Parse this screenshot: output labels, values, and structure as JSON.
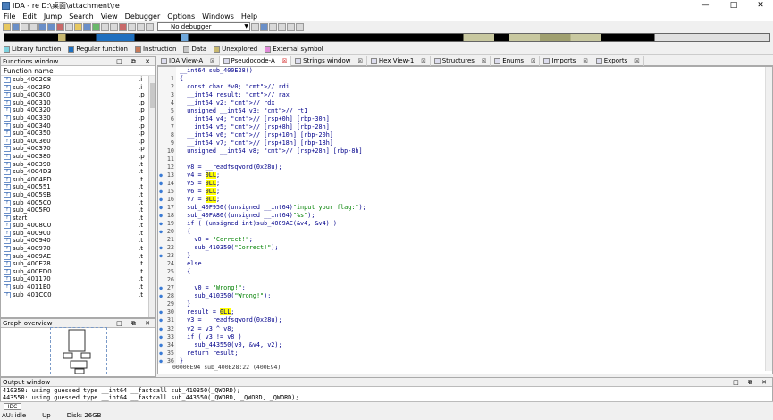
{
  "window": {
    "title": "IDA - re D:\\桌面\\attachment\\re",
    "min": "—",
    "max": "□",
    "close": "✕"
  },
  "menu": [
    "File",
    "Edit",
    "Jump",
    "Search",
    "View",
    "Debugger",
    "Options",
    "Windows",
    "Help"
  ],
  "toolbar": {
    "debugger_select": "No debugger"
  },
  "legend": [
    {
      "label": "Library function",
      "color": "#7fd3e0"
    },
    {
      "label": "Regular function",
      "color": "#1e6fbf"
    },
    {
      "label": "Instruction",
      "color": "#c87a5a"
    },
    {
      "label": "Data",
      "color": "#c8c8c8"
    },
    {
      "label": "Unexplored",
      "color": "#c8b870"
    },
    {
      "label": "External symbol",
      "color": "#e08ad8"
    }
  ],
  "functions_window": {
    "title": "Functions window",
    "header": "Function name",
    "items": [
      {
        "name": "sub_4002C8",
        "seg": ".i"
      },
      {
        "name": "sub_4002F0",
        "seg": ".i"
      },
      {
        "name": "sub_400300",
        "seg": ".p"
      },
      {
        "name": "sub_400310",
        "seg": ".p"
      },
      {
        "name": "sub_400320",
        "seg": ".p"
      },
      {
        "name": "sub_400330",
        "seg": ".p"
      },
      {
        "name": "sub_400340",
        "seg": ".p"
      },
      {
        "name": "sub_400350",
        "seg": ".p"
      },
      {
        "name": "sub_400360",
        "seg": ".p"
      },
      {
        "name": "sub_400370",
        "seg": ".p"
      },
      {
        "name": "sub_400380",
        "seg": ".p"
      },
      {
        "name": "sub_400390",
        "seg": ".t"
      },
      {
        "name": "sub_4004D3",
        "seg": ".t"
      },
      {
        "name": "sub_4004ED",
        "seg": ".t"
      },
      {
        "name": "sub_400551",
        "seg": ".t"
      },
      {
        "name": "sub_40059B",
        "seg": ".t"
      },
      {
        "name": "sub_4005C0",
        "seg": ".t"
      },
      {
        "name": "sub_4005F0",
        "seg": ".t"
      },
      {
        "name": "start",
        "seg": ".t"
      },
      {
        "name": "sub_4008C0",
        "seg": ".t"
      },
      {
        "name": "sub_400900",
        "seg": ".t"
      },
      {
        "name": "sub_400940",
        "seg": ".t"
      },
      {
        "name": "sub_400970",
        "seg": ".t"
      },
      {
        "name": "sub_4009AE",
        "seg": ".t"
      },
      {
        "name": "sub_400E28",
        "seg": ".t"
      },
      {
        "name": "sub_400ED0",
        "seg": ".t"
      },
      {
        "name": "sub_401170",
        "seg": ".t"
      },
      {
        "name": "sub_4011E0",
        "seg": ".t"
      },
      {
        "name": "sub_401CC0",
        "seg": ".t"
      }
    ]
  },
  "graph_overview": {
    "title": "Graph overview"
  },
  "tabs": [
    {
      "label": "IDA View-A"
    },
    {
      "label": "Pseudocode-A"
    },
    {
      "label": "Strings window"
    },
    {
      "label": "Hex View-1"
    },
    {
      "label": "Structures"
    },
    {
      "label": "Enums"
    },
    {
      "label": "Imports"
    },
    {
      "label": "Exports"
    }
  ],
  "code": {
    "header": "__int64 sub_400E28()",
    "lines": [
      {
        "n": "1",
        "dot": false,
        "t": "{"
      },
      {
        "n": "2",
        "dot": false,
        "t": "  const char *v0; // rdi"
      },
      {
        "n": "3",
        "dot": false,
        "t": "  __int64 result; // rax"
      },
      {
        "n": "4",
        "dot": false,
        "t": "  __int64 v2; // rdx"
      },
      {
        "n": "5",
        "dot": false,
        "t": "  unsigned __int64 v3; // rt1"
      },
      {
        "n": "6",
        "dot": false,
        "t": "  __int64 v4; // [rsp+0h] [rbp-30h]"
      },
      {
        "n": "7",
        "dot": false,
        "t": "  __int64 v5; // [rsp+8h] [rbp-28h]"
      },
      {
        "n": "8",
        "dot": false,
        "t": "  __int64 v6; // [rsp+10h] [rbp-20h]"
      },
      {
        "n": "9",
        "dot": false,
        "t": "  __int64 v7; // [rsp+18h] [rbp-18h]"
      },
      {
        "n": "10",
        "dot": false,
        "t": "  unsigned __int64 v8; // [rsp+28h] [rbp-8h]"
      },
      {
        "n": "11",
        "dot": false,
        "t": ""
      },
      {
        "n": "12",
        "dot": false,
        "t": "  v8 = __readfsqword(0x28u);"
      },
      {
        "n": "13",
        "dot": true,
        "t": "  v4 = 0LL;"
      },
      {
        "n": "14",
        "dot": true,
        "t": "  v5 = 0LL;"
      },
      {
        "n": "15",
        "dot": true,
        "t": "  v6 = 0LL;"
      },
      {
        "n": "16",
        "dot": true,
        "t": "  v7 = 0LL;"
      },
      {
        "n": "17",
        "dot": true,
        "t": "  sub_40F950((unsigned __int64)\"input your flag:\");"
      },
      {
        "n": "18",
        "dot": true,
        "t": "  sub_40FA80((unsigned __int64)\"%s\");"
      },
      {
        "n": "19",
        "dot": true,
        "t": "  if ( (unsigned int)sub_4009AE(&v4, &v4) )"
      },
      {
        "n": "20",
        "dot": true,
        "t": "  {"
      },
      {
        "n": "21",
        "dot": false,
        "t": "    v0 = \"Correct!\";"
      },
      {
        "n": "22",
        "dot": true,
        "t": "    sub_410350(\"Correct!\");"
      },
      {
        "n": "23",
        "dot": true,
        "t": "  }"
      },
      {
        "n": "24",
        "dot": false,
        "t": "  else"
      },
      {
        "n": "25",
        "dot": false,
        "t": "  {"
      },
      {
        "n": "26",
        "dot": false,
        "t": ""
      },
      {
        "n": "27",
        "dot": true,
        "t": "    v0 = \"Wrong!\";"
      },
      {
        "n": "28",
        "dot": true,
        "t": "    sub_410350(\"Wrong!\");"
      },
      {
        "n": "29",
        "dot": false,
        "t": "  }"
      },
      {
        "n": "30",
        "dot": true,
        "t": "  result = 0LL;"
      },
      {
        "n": "31",
        "dot": true,
        "t": "  v3 = __readfsqword(0x28u);"
      },
      {
        "n": "32",
        "dot": true,
        "t": "  v2 = v3 ^ v8;"
      },
      {
        "n": "33",
        "dot": true,
        "t": "  if ( v3 != v8 )"
      },
      {
        "n": "34",
        "dot": true,
        "t": "    sub_443550(v0, &v4, v2);"
      },
      {
        "n": "35",
        "dot": true,
        "t": "  return result;"
      },
      {
        "n": "36",
        "dot": true,
        "t": "}"
      }
    ],
    "status": "00000E94 sub_400E28:22 (400E94)"
  },
  "output_window": {
    "title": "Output window",
    "lines": [
      "410350: using guessed type __int64 __fastcall sub_410350(_QWORD);",
      "443550: using guessed type __int64 __fastcall sub_443550(_QWORD, _QWORD, _QWORD);"
    ],
    "idc": "IDC"
  },
  "statusbar": {
    "au": "AU:  idle",
    "dir": "Up",
    "disk": "Disk: 26GB"
  }
}
